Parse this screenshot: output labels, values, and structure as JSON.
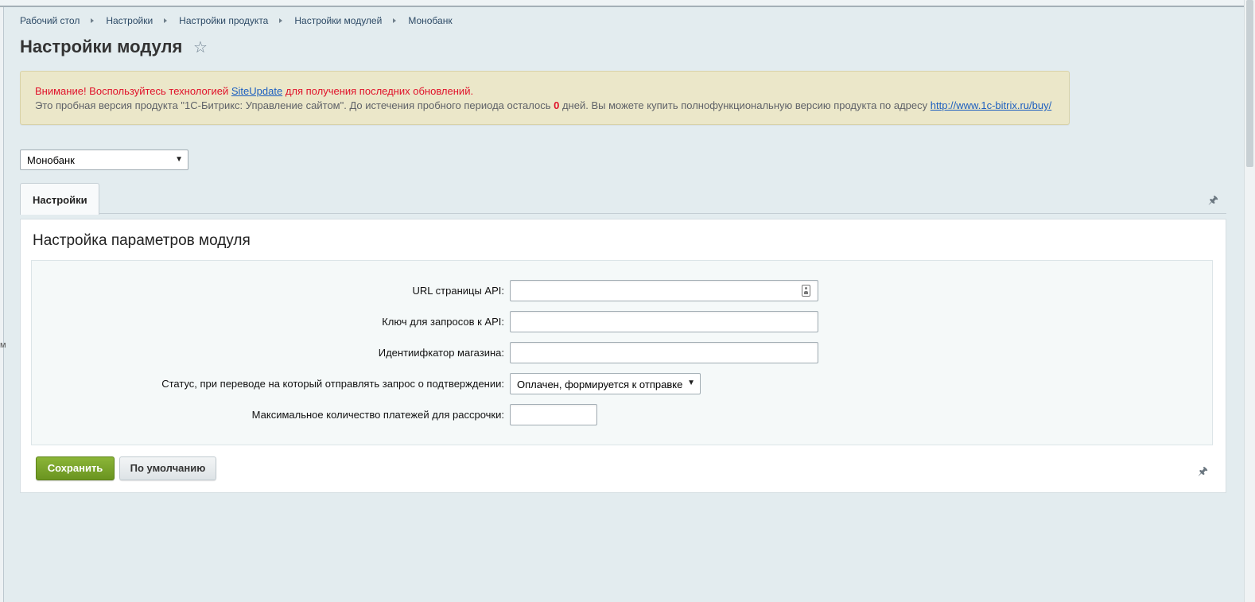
{
  "breadcrumb": {
    "items": [
      "Рабочий стол",
      "Настройки",
      "Настройки продукта",
      "Настройки модулей",
      "Монобанк"
    ]
  },
  "page": {
    "title": "Настройки модуля",
    "favorite_icon": "star-icon"
  },
  "notice": {
    "line1_prefix": "Внимание! Воспользуйтесь технологией ",
    "line1_link": "SiteUpdate",
    "line1_suffix": " для получения последних обновлений.",
    "line2_prefix": "Это пробная версия продукта \"1С-Битрикс: Управление сайтом\". До истечения пробного периода осталось ",
    "line2_days": "0",
    "line2_suffix": " дней. Вы можете купить полнофункциональную версию продукта по адресу ",
    "line2_link": "http://www.1c-bitrix.ru/buy/",
    "colors": {
      "warning": "#e0122a",
      "link": "#1d5fbf"
    }
  },
  "module_select": {
    "value": "Монобанк"
  },
  "tabs": [
    {
      "label": "Настройки",
      "active": true
    }
  ],
  "panel": {
    "title": "Настройка параметров модуля",
    "fields": [
      {
        "label": "URL страницы API:",
        "value": "",
        "type": "text"
      },
      {
        "label": "Ключ для запросов к API:",
        "value": "",
        "type": "text"
      },
      {
        "label": "Идентиифкатор магазина:",
        "value": "",
        "type": "text"
      },
      {
        "label": "Статус, при переводе на который отправлять запрос о подтверждении:",
        "value": "Оплачен, формируется к отправке",
        "type": "select"
      },
      {
        "label": "Максимальное количество платежей для рассрочки:",
        "value": "",
        "type": "text"
      }
    ]
  },
  "buttons": {
    "save": "Сохранить",
    "default": "По умолчанию",
    "save_color": "#7aa52c"
  },
  "left_edge_text": "м"
}
